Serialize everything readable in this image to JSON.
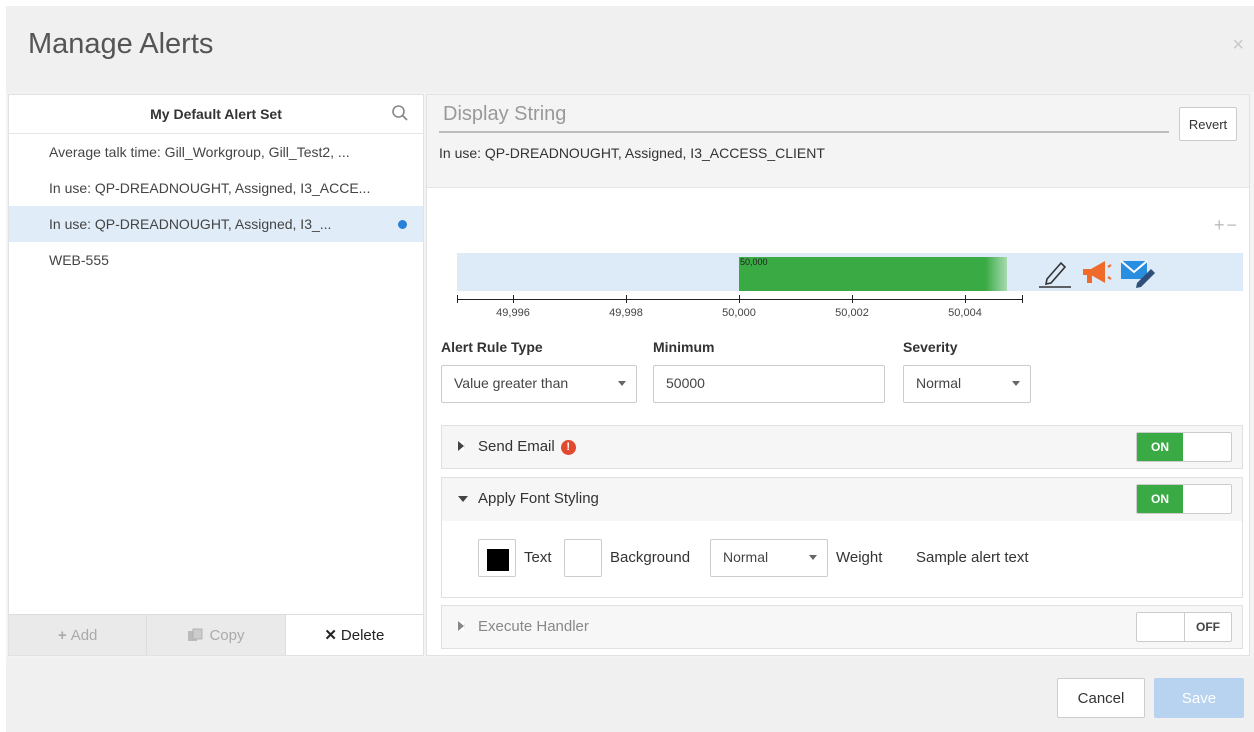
{
  "dialog": {
    "title": "Manage Alerts",
    "close_glyph": "×"
  },
  "left": {
    "set_name": "My Default Alert Set",
    "search_icon": "search-icon",
    "items": [
      {
        "label": "Average talk time: Gill_Workgroup, Gill_Test2, ..."
      },
      {
        "label": "In use: QP-DREADNOUGHT, Assigned, I3_ACCE..."
      },
      {
        "label": "In use: QP-DREADNOUGHT, Assigned, I3_...",
        "selected": true
      },
      {
        "label": "WEB-555"
      }
    ],
    "footer": {
      "add": "Add",
      "copy": "Copy",
      "delete": "Delete",
      "add_glyph": "+",
      "delete_glyph": "✕"
    }
  },
  "right": {
    "display_placeholder": "Display String",
    "revert": "Revert",
    "in_use": "In use: QP-DREADNOUGHT, Assigned, I3_ACCESS_CLIENT",
    "plus_minus": "+−",
    "meter": {
      "threshold_label": "50,000"
    },
    "axis": {
      "ticks": [
        {
          "label": "49,996",
          "value": 49996
        },
        {
          "label": "49,998",
          "value": 49998
        },
        {
          "label": "50,000",
          "value": 50000
        },
        {
          "label": "50,002",
          "value": 50002
        },
        {
          "label": "50,004",
          "value": 50004
        }
      ]
    },
    "rule_type": {
      "label": "Alert Rule Type",
      "value": "Value greater than"
    },
    "minimum": {
      "label": "Minimum",
      "value": "50000"
    },
    "severity": {
      "label": "Severity",
      "value": "Normal"
    },
    "send_email": {
      "title": "Send Email",
      "warn": "!",
      "toggle": "ON"
    },
    "font_styling": {
      "title": "Apply Font Styling",
      "toggle": "ON",
      "text_label": "Text",
      "background_label": "Background",
      "weight_value": "Normal",
      "weight_label": "Weight",
      "sample": "Sample alert text",
      "text_color": "#000000"
    },
    "execute_handler": {
      "title": "Execute Handler",
      "toggle": "OFF"
    }
  },
  "footer": {
    "cancel": "Cancel",
    "save": "Save"
  },
  "colors": {
    "accent_green": "#3aaa45",
    "selection_blue": "#e0ecf8",
    "dot_blue": "#2a7fd6",
    "warn_red": "#e24a2f"
  }
}
